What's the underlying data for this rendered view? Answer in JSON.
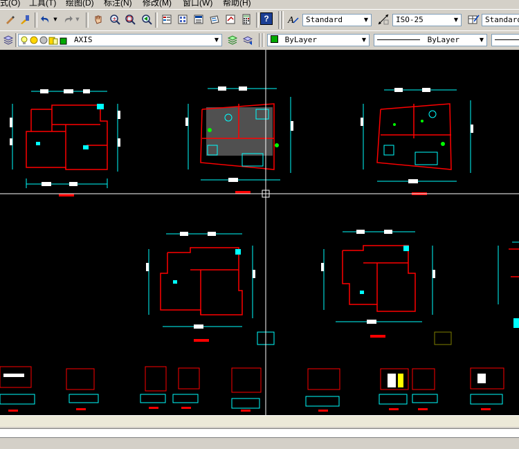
{
  "menu": {
    "items": [
      "式(O)",
      "工具(T)",
      "绘图(D)",
      "标注(N)",
      "修改(M)",
      "窗口(W)",
      "帮助(H)"
    ]
  },
  "toolbar": {
    "text_style_value": "Standard",
    "dim_style_value": "ISO-25",
    "table_style_value": "Standard"
  },
  "layers": {
    "current_layer": "AXIS",
    "color_value": "ByLayer",
    "linetype_value": "ByLayer"
  },
  "icons": {
    "arrow": "▼",
    "help": "?"
  },
  "colors": {
    "canvas_bg": "#000000",
    "wall_red": "#ff0000",
    "dim_cyan": "#00ffff",
    "crosshair": "#ffffff",
    "layer_green": "#00aa00"
  }
}
